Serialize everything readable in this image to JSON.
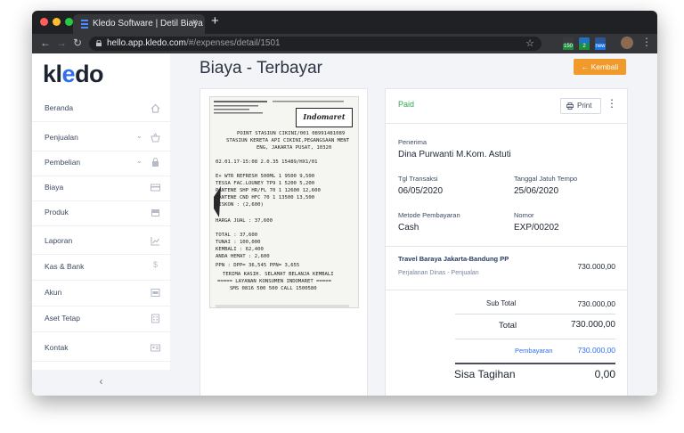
{
  "browser": {
    "tab_title": "Kledo Software | Detil Biaya",
    "url_host": "hello.app.kledo.com",
    "url_path": "/#/expenses/detail/1501",
    "ext1_badge": "150",
    "ext2_badge": "2",
    "ext3_badge": "new"
  },
  "sidebar": {
    "logo_k": "kl",
    "logo_e": "e",
    "logo_rest": "do",
    "items": [
      {
        "label": "Beranda"
      },
      {
        "label": "Penjualan"
      },
      {
        "label": "Pembelian"
      },
      {
        "label": "Biaya"
      },
      {
        "label": "Produk"
      },
      {
        "label": "Laporan"
      },
      {
        "label": "Kas & Bank"
      },
      {
        "label": "Akun"
      },
      {
        "label": "Aset Tetap"
      },
      {
        "label": "Kontak"
      }
    ]
  },
  "page": {
    "title": "Biaya - Terbayar",
    "back_label": "← Kembali"
  },
  "receipt": {
    "lines": [
      "POINT STASIUN CIKINI/001 08991481089",
      "STASIUN KERETA API CIKINI,PEGANGSAAN MENT",
      "ENG, JAKARTA PUSAT, 10320",
      "02.01.17-15:08  2.0.35    15489/HX1/01",
      "E+ WTR REFRESH 500ML  1   9500   9,500",
      "TESSA FAC.LOUNEY TP9  1   5200   5,200",
      "PANTENE SHP HR/FL 70  1  12600  12,600",
      "PANTENE CND HFC 70    1  13500  13,500",
      "                      DISKON :  (2,600)",
      "              HARGA JUAL :    37,600",
      "                   TOTAL :    37,600",
      "                   TUNAI :   100,000",
      "                 KEMBALI :    62,400",
      "               ANDA HEMAT :     2,600",
      "PPN      : DPP= 36,545 PPN= 3,655",
      "TERIMA KASIH. SELAMAT BELANJA KEMBALI",
      "===== LAYANAN KONSUMEN INDOMARET =====",
      "SMS 0816 500 500  CALL 1500580"
    ],
    "logo_text": "Indomaret"
  },
  "detail": {
    "status": "Paid",
    "print_label": "Print",
    "more_icon": "⋮",
    "penerima_label": "Penerima",
    "penerima_value": "Dina Purwanti M.Kom. Astuti",
    "tgl_transaksi_label": "Tgl Transaksi",
    "tgl_transaksi_value": "06/05/2020",
    "jatuh_tempo_label": "Tanggal Jatuh Tempo",
    "jatuh_tempo_value": "25/06/2020",
    "metode_label": "Metode Pembayaran",
    "metode_value": "Cash",
    "nomor_label": "Nomor",
    "nomor_value": "EXP/00202",
    "item_name": "Travel Baraya Jakarta-Bandung PP",
    "item_desc": "Perjalanan Dinas - Penjualan",
    "item_amount": "730.000,00",
    "subtotal_label": "Sub Total",
    "subtotal_value": "730.000,00",
    "total_label": "Total",
    "total_value": "730.000,00",
    "pembayaran_label": "Pembayaran",
    "pembayaran_value": "730.000,00",
    "sisa_label": "Sisa Tagihan",
    "sisa_value": "0,00"
  },
  "colors": {
    "accent": "#2f6fed",
    "back_button": "#f09a2c",
    "paid": "#2fa84f"
  }
}
